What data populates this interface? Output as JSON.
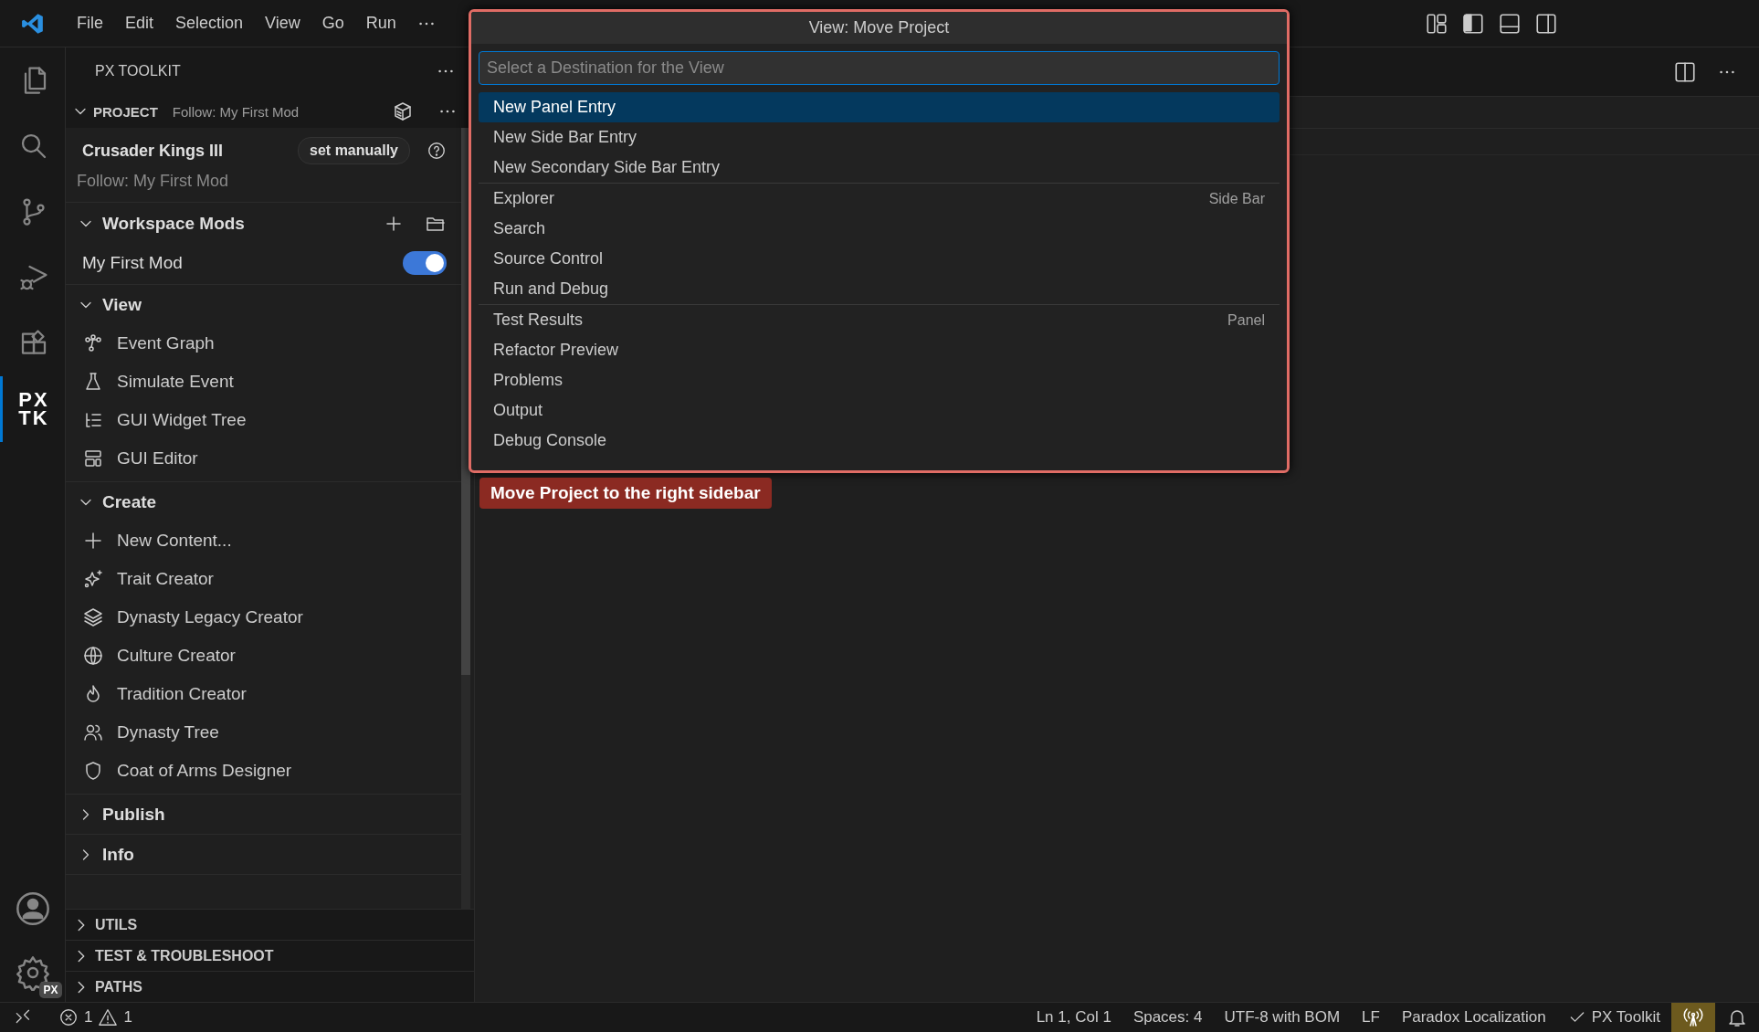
{
  "menu_bar": {
    "items": [
      "File",
      "Edit",
      "Selection",
      "View",
      "Go",
      "Run"
    ]
  },
  "activity_bar": {
    "items": [
      {
        "kind": "files",
        "selected": false
      },
      {
        "kind": "search",
        "selected": false
      },
      {
        "kind": "scm",
        "selected": false
      },
      {
        "kind": "debug",
        "selected": false
      },
      {
        "kind": "extensions",
        "selected": false
      },
      {
        "kind": "logo",
        "label_top": "PX",
        "label_bottom": "TK",
        "selected": true
      }
    ],
    "settings_badge": "PX"
  },
  "sidebar": {
    "title": "PX TOOLKIT",
    "project": {
      "title": "PROJECT",
      "description": "Follow: My First Mod",
      "expanded": true
    },
    "game": {
      "name": "Crusader Kings III",
      "button": "set manually",
      "follow": "Follow: My First Mod"
    },
    "groups": [
      {
        "title": "Workspace Mods",
        "kind": "mods",
        "expanded": true,
        "items": [
          {
            "label": "My First Mod",
            "on": true
          }
        ]
      },
      {
        "title": "View",
        "kind": "commands",
        "expanded": true,
        "items": [
          {
            "label": "Event Graph"
          },
          {
            "label": "Simulate Event"
          },
          {
            "label": "GUI Widget Tree"
          },
          {
            "label": "GUI Editor"
          }
        ]
      },
      {
        "title": "Create",
        "kind": "commands",
        "expanded": true,
        "items": [
          {
            "label": "New Content..."
          },
          {
            "label": "Trait Creator"
          },
          {
            "label": "Dynasty Legacy Creator"
          },
          {
            "label": "Culture Creator"
          },
          {
            "label": "Tradition Creator"
          },
          {
            "label": "Dynasty Tree"
          },
          {
            "label": "Coat of Arms Designer"
          }
        ]
      },
      {
        "title": "Publish",
        "kind": "commands",
        "expanded": false
      },
      {
        "title": "Info",
        "kind": "commands",
        "expanded": false
      }
    ],
    "sections": [
      {
        "title": "UTILS",
        "expanded": false
      },
      {
        "title": "TEST & TROUBLESHOOT",
        "expanded": false
      },
      {
        "title": "PATHS",
        "expanded": false
      }
    ]
  },
  "quick_pick": {
    "title": "View: Move Project",
    "placeholder": "Select a Destination for the View",
    "groups": [
      {
        "items": [
          {
            "label": "New Panel Entry",
            "selected": true
          },
          {
            "label": "New Side Bar Entry",
            "selected": false
          },
          {
            "label": "New Secondary Side Bar Entry",
            "selected": false
          }
        ]
      },
      {
        "label": "Side Bar",
        "items": [
          {
            "label": "Explorer",
            "selected": false
          },
          {
            "label": "Search",
            "selected": false
          },
          {
            "label": "Source Control",
            "selected": false
          },
          {
            "label": "Run and Debug",
            "selected": false
          }
        ]
      },
      {
        "label": "Panel",
        "items": [
          {
            "label": "Test Results",
            "selected": false
          },
          {
            "label": "Refactor Preview",
            "selected": false
          },
          {
            "label": "Problems",
            "selected": false
          },
          {
            "label": "Output",
            "selected": false
          },
          {
            "label": "Debug Console",
            "selected": false
          }
        ]
      }
    ]
  },
  "tooltip": {
    "text": "Move Project to the right sidebar"
  },
  "status_bar": {
    "errors": "1",
    "warnings": "1",
    "items": [
      "Ln 1, Col 1",
      "Spaces: 4",
      "UTF-8 with BOM",
      "LF",
      "Paradox Localization"
    ],
    "extension": "PX Toolkit"
  }
}
